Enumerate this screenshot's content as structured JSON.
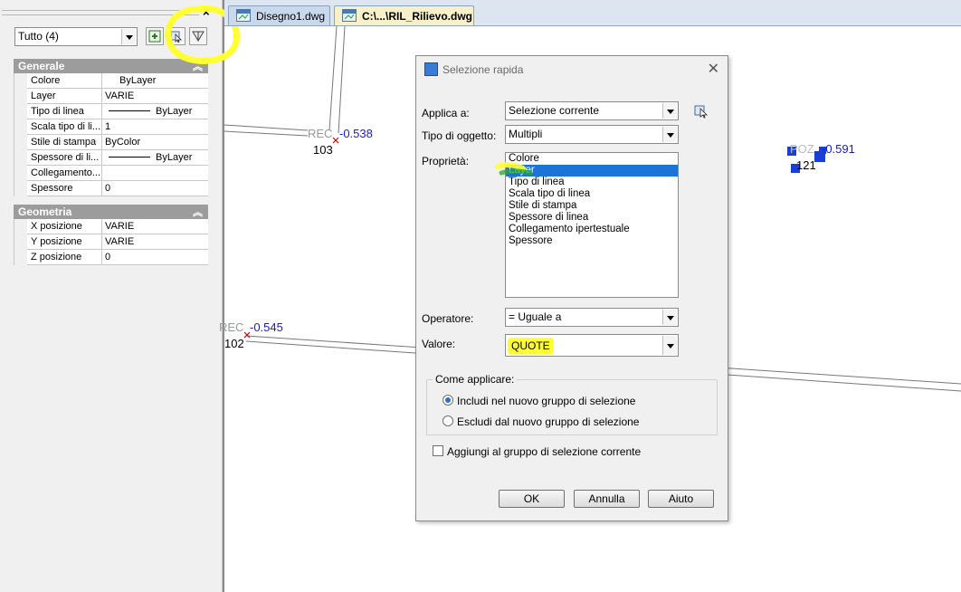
{
  "palette": {
    "close_glyph": "×",
    "filter_combo": "Tutto (4)",
    "sections": [
      {
        "title": "Generale",
        "rows": [
          {
            "name": "Colore",
            "value": "ByLayer",
            "style": "indent"
          },
          {
            "name": "Layer",
            "value": "VARIE",
            "style": "plain"
          },
          {
            "name": "Tipo di linea",
            "value": "ByLayer",
            "style": "line"
          },
          {
            "name": "Scala tipo di li...",
            "value": "1",
            "style": "plain"
          },
          {
            "name": "Stile di stampa",
            "value": "ByColor",
            "style": "plain"
          },
          {
            "name": "Spessore di li...",
            "value": "ByLayer",
            "style": "line"
          },
          {
            "name": "Collegamento...",
            "value": "",
            "style": "plain"
          },
          {
            "name": "Spessore",
            "value": "0",
            "style": "plain"
          }
        ]
      },
      {
        "title": "Geometria",
        "rows": [
          {
            "name": "X posizione",
            "value": "VARIE",
            "style": "plain"
          },
          {
            "name": "Y posizione",
            "value": "VARIE",
            "style": "plain"
          },
          {
            "name": "Z posizione",
            "value": "0",
            "style": "plain"
          }
        ]
      }
    ],
    "tool_icons": [
      "add-object-icon",
      "quick-select-icon",
      "select-objects-icon"
    ]
  },
  "tabs": [
    {
      "label": "Disegno1.dwg",
      "icon": "dwg-file-icon",
      "active": false
    },
    {
      "label": "C:\\...\\RIL_Rilievo.dwg",
      "icon": "dwg-file-icon",
      "active": true
    }
  ],
  "drawing": {
    "labels": [
      {
        "code": "REC",
        "value": "-0.538",
        "number": "103"
      },
      {
        "code": "REC",
        "value": "-0.545",
        "number": "102"
      },
      {
        "code": "POZ",
        "value": "-0.591",
        "number": "121"
      }
    ]
  },
  "dialog": {
    "title": "Selezione rapida",
    "close_glyph": "✕",
    "applica_label": "Applica a:",
    "applica_value": "Selezione corrente",
    "tipo_label": "Tipo di oggetto:",
    "tipo_value": "Multipli",
    "proprieta_label": "Proprietà:",
    "properties": [
      "Colore",
      "Layer",
      "Tipo di linea",
      "Scala tipo di linea",
      "Stile di stampa",
      "Spessore di linea",
      "Collegamento ipertestuale",
      "Spessore"
    ],
    "selected_property": "Layer",
    "operatore_label": "Operatore:",
    "operatore_value": "= Uguale a",
    "valore_label": "Valore:",
    "valore_value": "QUOTE",
    "come_applicare_label": "Come applicare:",
    "radio_include": "Includi nel nuovo gruppo di selezione",
    "radio_exclude": "Escludi dal nuovo gruppo di selezione",
    "radio_selected": "include",
    "checkbox_append": "Aggiungi al gruppo di selezione corrente",
    "checkbox_checked": false,
    "ok_button": "OK",
    "cancel_button": "Annulla",
    "help_button": "Aiuto"
  },
  "colors": {
    "highlight_yellow": "#ffff33",
    "selection_blue": "#1c74d6",
    "cad_value_blue": "#1a1acc",
    "cad_marker_red": "#d00000"
  }
}
